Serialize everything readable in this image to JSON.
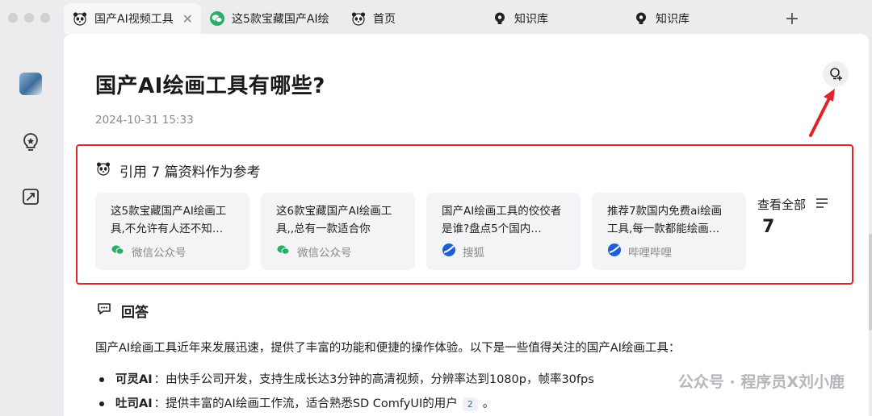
{
  "tabs": [
    {
      "label": "国产AI视频工具",
      "icon": "panda-icon",
      "active": true
    },
    {
      "label": "这5款宝藏国产AI绘",
      "icon": "wechat-icon",
      "active": false
    },
    {
      "label": "首页",
      "icon": "panda-icon",
      "active": false
    },
    {
      "label": "知识库",
      "icon": "bulb-icon",
      "active": false
    },
    {
      "label": "知识库",
      "icon": "bulb-icon",
      "active": false
    }
  ],
  "new_tab_label": "+",
  "tab_close_glyph": "✕",
  "page": {
    "title": "国产AI绘画工具有哪些?",
    "timestamp": "2024-10-31 15:33"
  },
  "references": {
    "heading": "引用 7 篇资料作为参考",
    "cards": [
      {
        "title": "这5款宝藏国产AI绘画工具,不允许有人还不知…",
        "source": "微信公众号",
        "source_icon": "wechat-icon"
      },
      {
        "title": "这6款宝藏国产AI绘画工具,,总有一款适合你",
        "source": "微信公众号",
        "source_icon": "wechat-icon"
      },
      {
        "title": "国产AI绘画工具的佼佼者是谁?盘点5个国内…",
        "source": "搜狐",
        "source_icon": "sohu-icon"
      },
      {
        "title": "推荐7款国内免费ai绘画工具,每一款都能绘画…",
        "source": "哔哩哔哩",
        "source_icon": "bilibili-icon"
      }
    ],
    "view_all_label": "查看全部",
    "count": "7"
  },
  "answer": {
    "heading": "回答",
    "intro": "国产AI绘画工具近年来发展迅速，提供了丰富的功能和便捷的操作体验。以下是一些值得关注的国产AI绘画工具：",
    "items": [
      {
        "name": "可灵AI",
        "text": "：由快手公司开发，支持生成长达3分钟的高清视频，分辨率达到1080p，帧率30fps",
        "cite": ""
      },
      {
        "name": "吐司AI",
        "text": "：提供丰富的AI绘画工作流，适合熟悉SD ComfyUI的用户",
        "cite": "2",
        "tail": "。"
      }
    ]
  },
  "watermark": "公众号 · 程序员X刘小鹿",
  "colors": {
    "highlight_border": "#e0242c",
    "annotation_arrow": "#e0242c"
  }
}
